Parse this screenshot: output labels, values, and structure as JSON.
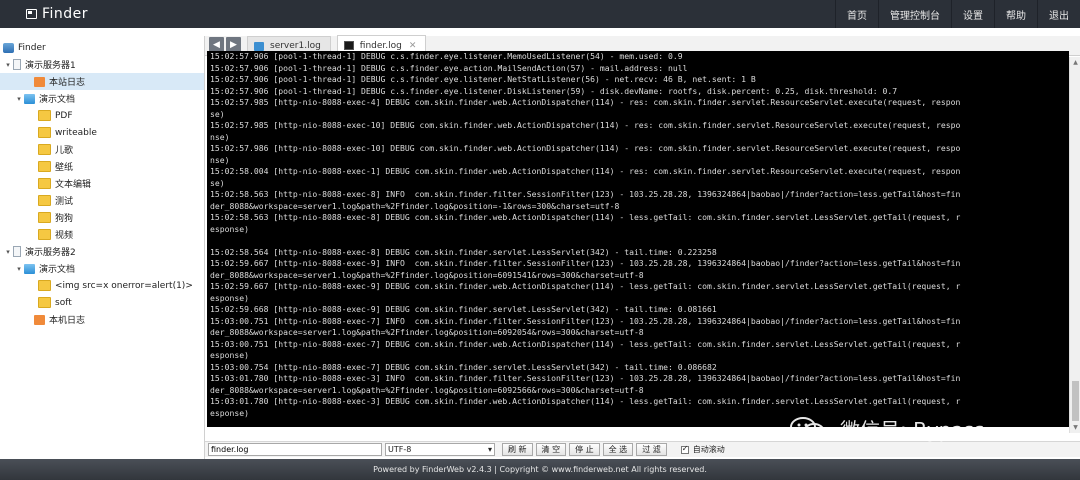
{
  "header": {
    "brand": "Finder",
    "nav": [
      "首页",
      "管理控制台",
      "设置",
      "帮助",
      "退出"
    ]
  },
  "tree": [
    {
      "label": "Finder",
      "icon": "root",
      "level": 0,
      "toggle": ""
    },
    {
      "label": "演示服务器1",
      "icon": "server",
      "level": 0,
      "toggle": "▾"
    },
    {
      "label": "本站日志",
      "icon": "log",
      "level": 1,
      "toggle": "",
      "selected": true
    },
    {
      "label": "演示文档",
      "icon": "docs",
      "level": 1,
      "toggle": "▾"
    },
    {
      "label": "PDF",
      "icon": "folder",
      "level": 2,
      "toggle": ""
    },
    {
      "label": "writeable",
      "icon": "folder",
      "level": 2,
      "toggle": ""
    },
    {
      "label": "儿歌",
      "icon": "folder",
      "level": 2,
      "toggle": ""
    },
    {
      "label": "壁纸",
      "icon": "folder",
      "level": 2,
      "toggle": ""
    },
    {
      "label": "文本编辑",
      "icon": "folder",
      "level": 2,
      "toggle": ""
    },
    {
      "label": "测试",
      "icon": "folder",
      "level": 2,
      "toggle": ""
    },
    {
      "label": "狗狗",
      "icon": "folder",
      "level": 2,
      "toggle": ""
    },
    {
      "label": "视频",
      "icon": "folder",
      "level": 2,
      "toggle": ""
    },
    {
      "label": "演示服务器2",
      "icon": "server",
      "level": 0,
      "toggle": "▾"
    },
    {
      "label": "演示文档",
      "icon": "docs",
      "level": 1,
      "toggle": "▾"
    },
    {
      "label": "<img src=x onerror=alert(1)>",
      "icon": "folder",
      "level": 2,
      "toggle": ""
    },
    {
      "label": "soft",
      "icon": "folder",
      "level": 2,
      "toggle": ""
    },
    {
      "label": "本机日志",
      "icon": "log",
      "level": 1,
      "toggle": ""
    }
  ],
  "tabs": [
    {
      "label": "server1.log",
      "icon": "web",
      "active": false
    },
    {
      "label": "finder.log",
      "icon": "term",
      "active": true
    }
  ],
  "console_lines": [
    "15:02:57.906 [pool-1-thread-1] DEBUG c.s.finder.eye.listener.MemoUsedListener(54) - mem.used: 0.9",
    "15:02:57.906 [pool-1-thread-1] DEBUG c.s.finder.eye.action.MailSendAction(57) - mail.address: null",
    "15:02:57.906 [pool-1-thread-1] DEBUG c.s.finder.eye.listener.NetStatListener(56) - net.recv: 46 B, net.sent: 1 B",
    "15:02:57.906 [pool-1-thread-1] DEBUG c.s.finder.eye.listener.DiskListener(59) - disk.devName: rootfs, disk.percent: 0.25, disk.threshold: 0.7",
    "15:02:57.985 [http-nio-8088-exec-4] DEBUG com.skin.finder.web.ActionDispatcher(114) - res: com.skin.finder.servlet.ResourceServlet.execute(request, respon",
    "se)",
    "15:02:57.985 [http-nio-8088-exec-10] DEBUG com.skin.finder.web.ActionDispatcher(114) - res: com.skin.finder.servlet.ResourceServlet.execute(request, respo",
    "nse)",
    "15:02:57.986 [http-nio-8088-exec-10] DEBUG com.skin.finder.web.ActionDispatcher(114) - res: com.skin.finder.servlet.ResourceServlet.execute(request, respo",
    "nse)",
    "15:02:58.004 [http-nio-8088-exec-1] DEBUG com.skin.finder.web.ActionDispatcher(114) - res: com.skin.finder.servlet.ResourceServlet.execute(request, respon",
    "se)",
    "15:02:58.563 [http-nio-8088-exec-8] INFO  com.skin.finder.filter.SessionFilter(123) - 103.25.28.28, 1396324864|baobao|/finder?action=less.getTail&host=fin",
    "der_8088&workspace=server1.log&path=%2Ffinder.log&position=-1&rows=300&charset=utf-8",
    "15:02:58.563 [http-nio-8088-exec-8] DEBUG com.skin.finder.web.ActionDispatcher(114) - less.getTail: com.skin.finder.servlet.LessServlet.getTail(request, r",
    "esponse)",
    "",
    "15:02:58.564 [http-nio-8088-exec-8] DEBUG com.skin.finder.servlet.LessServlet(342) - tail.time: 0.223258",
    "15:02:59.667 [http-nio-8088-exec-9] INFO  com.skin.finder.filter.SessionFilter(123) - 103.25.28.28, 1396324864|baobao|/finder?action=less.getTail&host=fin",
    "der_8088&workspace=server1.log&path=%2Ffinder.log&position=6091541&rows=300&charset=utf-8",
    "15:02:59.667 [http-nio-8088-exec-9] DEBUG com.skin.finder.web.ActionDispatcher(114) - less.getTail: com.skin.finder.servlet.LessServlet.getTail(request, r",
    "esponse)",
    "15:02:59.668 [http-nio-8088-exec-9] DEBUG com.skin.finder.servlet.LessServlet(342) - tail.time: 0.081661",
    "15:03:00.751 [http-nio-8088-exec-7] INFO  com.skin.finder.filter.SessionFilter(123) - 103.25.28.28, 1396324864|baobao|/finder?action=less.getTail&host=fin",
    "der_8088&workspace=server1.log&path=%2Ffinder.log&position=6092054&rows=300&charset=utf-8",
    "15:03:00.751 [http-nio-8088-exec-7] DEBUG com.skin.finder.web.ActionDispatcher(114) - less.getTail: com.skin.finder.servlet.LessServlet.getTail(request, r",
    "esponse)",
    "15:03:00.754 [http-nio-8088-exec-7] DEBUG com.skin.finder.servlet.LessServlet(342) - tail.time: 0.086682",
    "15:03:01.780 [http-nio-8088-exec-3] INFO  com.skin.finder.filter.SessionFilter(123) - 103.25.28.28, 1396324864|baobao|/finder?action=less.getTail&host=fin",
    "der_8088&workspace=server1.log&path=%2Ffinder.log&position=6092566&rows=300&charset=utf-8",
    "15:03:01.780 [http-nio-8088-exec-3] DEBUG com.skin.finder.web.ActionDispatcher(114) - less.getTail: com.skin.finder.servlet.LessServlet.getTail(request, r",
    "esponse)"
  ],
  "toolbar": {
    "file_value": "finder.log",
    "charset": "UTF-8",
    "buttons": [
      "刷 新",
      "清 空",
      "停 止",
      "全 选",
      "过 滤"
    ],
    "auto_scroll_label": "自动滚动",
    "auto_scroll_checked": true
  },
  "footer": {
    "text": "Powered by FinderWeb v2.4.3 | Copyright © www.finderweb.net All rights reserved."
  },
  "watermark": {
    "text": "微信号: Bypass--"
  }
}
